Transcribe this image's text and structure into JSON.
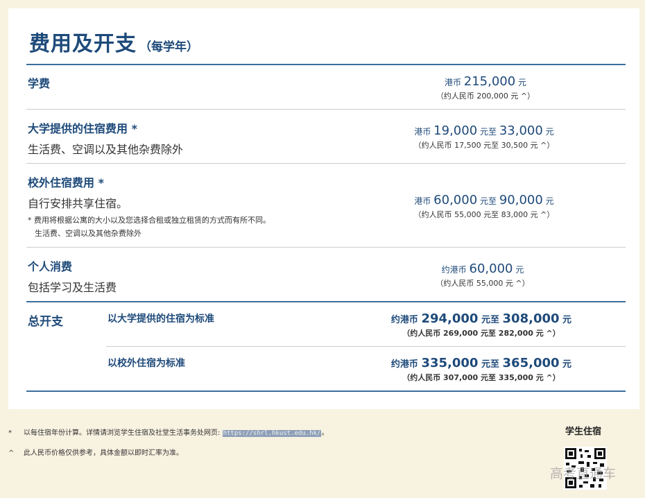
{
  "title": "费用及开支",
  "title_sub": "（每学年）",
  "tuition": {
    "label": "学费",
    "prefix": "港币",
    "amount": "215,000",
    "suffix": "元",
    "rmb": "（约人民币 200,000 元 ^）"
  },
  "campus_housing": {
    "label": "大学提供的住宿费用 *",
    "desc": "生活费、空调以及其他杂费除外",
    "prefix": "港币",
    "amount_low": "19,000",
    "mid": "元至",
    "amount_high": "33,000",
    "suffix": "元",
    "rmb": "（约人民币 17,500 元至 30,500 元 ^）"
  },
  "offcampus_housing": {
    "label": "校外住宿费用 *",
    "desc": "自行安排共享住宿。",
    "note1": "* 费用将根据公寓的大小以及您选择合租或独立租赁的方式而有所不同。",
    "note2": "生活费、空调以及其他杂费除外",
    "prefix": "港币",
    "amount_low": "60,000",
    "mid": "元至",
    "amount_high": "90,000",
    "suffix": "元",
    "rmb": "（约人民币 55,000 元至 83,000 元 ^）"
  },
  "personal": {
    "label": "个人消费",
    "desc": "包括学习及生活费",
    "prefix": "约港币",
    "amount": "60,000",
    "suffix": "元",
    "rmb": "（约人民币 55,000 元 ^）"
  },
  "total": {
    "label": "总开支",
    "row1": {
      "label": "以大学提供的住宿为标准",
      "prefix": "约港币",
      "amount_low": "294,000",
      "mid": "元至",
      "amount_high": "308,000",
      "suffix": "元",
      "rmb": "（约人民币 269,000 元至 282,000 元 ^）"
    },
    "row2": {
      "label": "以校外住宿为标准",
      "prefix": "约港币",
      "amount_low": "335,000",
      "mid": "元至",
      "amount_high": "365,000",
      "suffix": "元",
      "rmb": "（约人民币 307,000 元至 335,000 元 ^）"
    }
  },
  "footnotes": {
    "f1_mark": "*",
    "f1_text": "以每住宿年份计算。详情请浏览学生住宿及社堂生活事务处网页:",
    "f1_link": "https://shrl.hkust.edu.hk/",
    "f1_end": "。",
    "f2_mark": "^",
    "f2_text": "此人民币价格仅供参考，具体金额以即时汇率为准。"
  },
  "qr_label": "学生住宿",
  "watermark": "高考直通车",
  "colors": {
    "heading": "#1e4a7a",
    "rule": "#3a6f9e",
    "background": "#f8f2e1"
  }
}
